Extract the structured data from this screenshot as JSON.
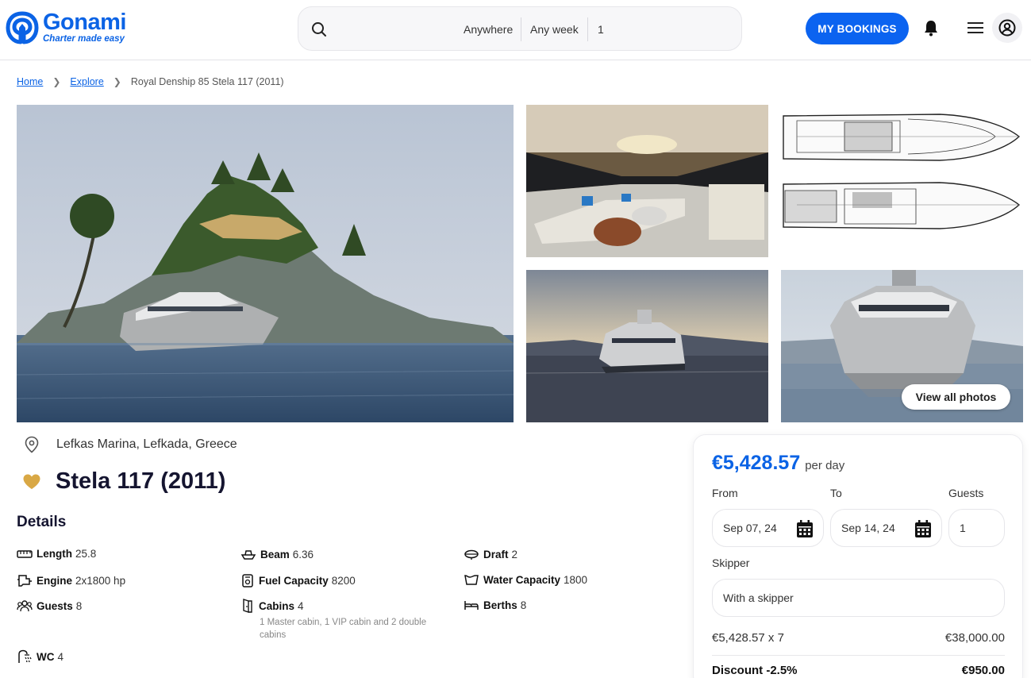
{
  "brand": {
    "name": "Gonami",
    "tagline": "Charter made easy"
  },
  "search": {
    "location": "Anywhere",
    "week": "Any week",
    "guests": "1"
  },
  "header": {
    "bookings_label": "MY BOOKINGS"
  },
  "breadcrumb": {
    "home": "Home",
    "explore": "Explore",
    "current": "Royal Denship 85 Stela 117 (2011)"
  },
  "gallery": {
    "view_all_label": "View all photos"
  },
  "listing": {
    "location": "Lefkas Marina, Lefkada, Greece",
    "title": "Stela 117 (2011)",
    "details_heading": "Details",
    "specs": {
      "length": {
        "label": "Length",
        "value": "25.8"
      },
      "beam": {
        "label": "Beam",
        "value": "6.36"
      },
      "draft": {
        "label": "Draft",
        "value": "2"
      },
      "engine": {
        "label": "Engine",
        "value": "2x1800 hp"
      },
      "fuel": {
        "label": "Fuel Capacity",
        "value": "8200"
      },
      "water": {
        "label": "Water Capacity",
        "value": "1800"
      },
      "guests": {
        "label": "Guests",
        "value": "8"
      },
      "cabins": {
        "label": "Cabins",
        "value": "4",
        "note": "1 Master cabin, 1 VIP cabin and 2 double cabins"
      },
      "berths": {
        "label": "Berths",
        "value": "8"
      },
      "wc": {
        "label": "WC",
        "value": "4"
      }
    }
  },
  "booking": {
    "price": "€5,428.57",
    "price_unit": "per day",
    "from_label": "From",
    "to_label": "To",
    "guests_label": "Guests",
    "from_value": "Sep 07, 24",
    "to_value": "Sep 14, 24",
    "guests_value": "1",
    "skipper_label": "Skipper",
    "skipper_value": "With a skipper",
    "subtotal_label": "€5,428.57 x 7",
    "subtotal_value": "€38,000.00",
    "discount_label": "Discount -2.5%",
    "discount_value": "€950.00"
  },
  "colors": {
    "accent": "#0b63f0",
    "favorite": "#d9a845",
    "text_dark": "#151530"
  }
}
